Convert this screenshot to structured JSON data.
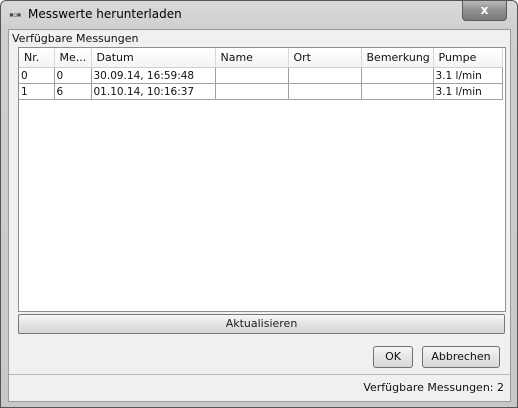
{
  "window": {
    "title": "Messwerte herunterladen",
    "close_label": "x"
  },
  "group": {
    "title": "Verfügbare Messungen"
  },
  "table": {
    "columns": [
      "Nr.",
      "Me...",
      "Datum",
      "Name",
      "Ort",
      "Bemerkung",
      "Pumpe"
    ],
    "rows": [
      [
        "0",
        "0",
        "30.09.14, 16:59:48",
        "",
        "",
        "",
        "3.1 l/min"
      ],
      [
        "1",
        "6",
        "01.10.14, 10:16:37",
        "",
        "",
        "",
        "3.1 l/min"
      ]
    ]
  },
  "buttons": {
    "refresh": "Aktualisieren",
    "ok": "OK",
    "cancel": "Abbrechen"
  },
  "status": {
    "text": "Verfügbare Messungen: 2"
  }
}
